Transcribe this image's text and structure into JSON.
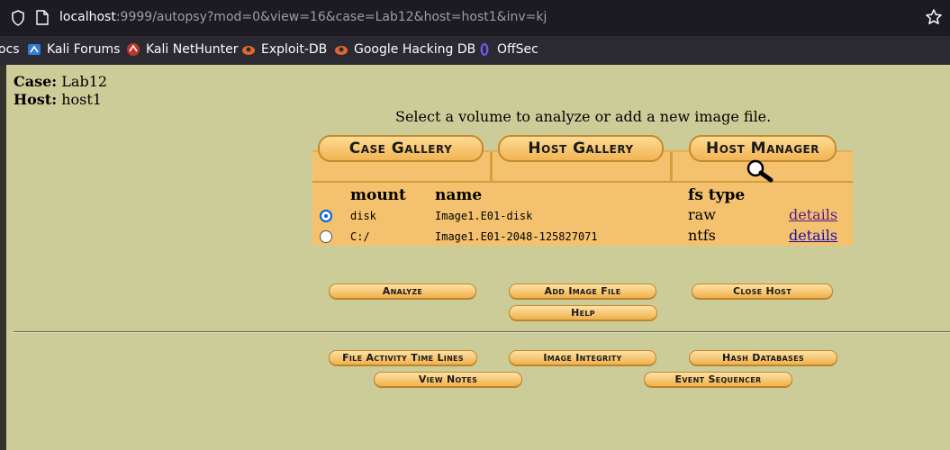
{
  "browser": {
    "url_host": "localhost",
    "url_rest": ":9999/autopsy?mod=0&view=16&case=Lab12&host=host1&inv=kj",
    "bookmarks": [
      {
        "label": "ocs",
        "icon": "docs-icon"
      },
      {
        "label": "Kali Forums",
        "icon": "kali-forums-icon"
      },
      {
        "label": "Kali NetHunter",
        "icon": "kali-nethunter-icon"
      },
      {
        "label": "Exploit-DB",
        "icon": "exploit-db-icon"
      },
      {
        "label": "Google Hacking DB",
        "icon": "google-hacking-db-icon"
      },
      {
        "label": "OffSec",
        "icon": "offsec-icon"
      }
    ]
  },
  "case": {
    "case_label": "Case:",
    "case_value": "Lab12",
    "host_label": "Host:",
    "host_value": "host1"
  },
  "instruction": "Select a volume to analyze or add a new image file.",
  "tabs": {
    "case_gallery": "Case Gallery",
    "host_gallery": "Host Gallery",
    "host_manager": "Host Manager"
  },
  "table": {
    "headers": {
      "mount": "mount",
      "name": "name",
      "fs_type": "fs type"
    },
    "rows": [
      {
        "mount": "disk",
        "name": "Image1.E01-disk",
        "fs_type": "raw",
        "details": "details",
        "selected": true
      },
      {
        "mount": "C:/",
        "name": "Image1.E01-2048-125827071",
        "fs_type": "ntfs",
        "details": "details",
        "selected": false
      }
    ]
  },
  "buttons": {
    "analyze": "Analyze",
    "add_image_file": "Add Image File",
    "close_host": "Close Host",
    "help": "Help",
    "file_activity_time_lines": "File Activity Time Lines",
    "image_integrity": "Image Integrity",
    "hash_databases": "Hash Databases",
    "view_notes": "View Notes",
    "event_sequencer": "Event Sequencer"
  },
  "colors": {
    "page_bg": "#cccc99",
    "panel": "#f4c26e",
    "button": "#f0b14e"
  }
}
